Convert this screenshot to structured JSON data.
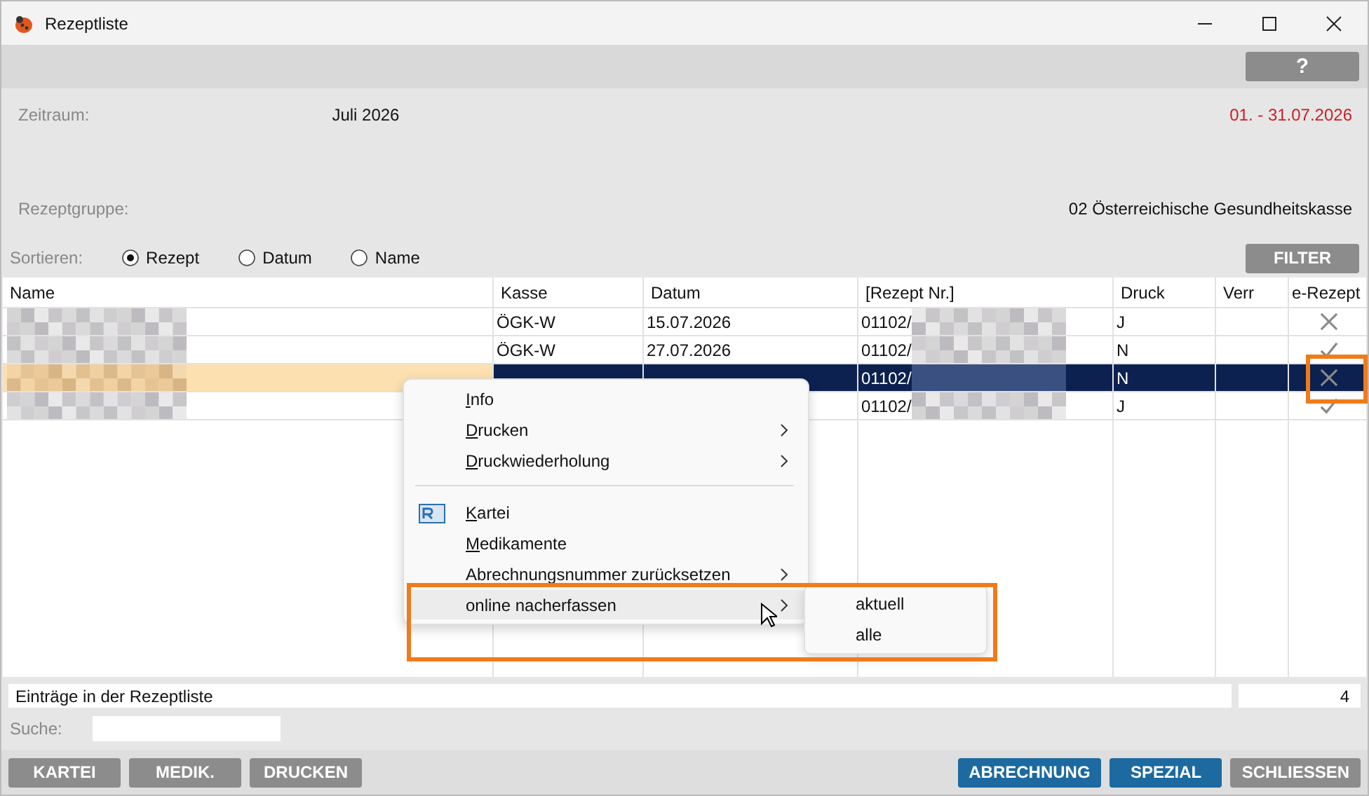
{
  "window": {
    "title": "Rezeptliste"
  },
  "help_button": "?",
  "period": {
    "label": "Zeitraum:",
    "value": "Juli 2026",
    "range": "01. - 31.07.2026"
  },
  "group": {
    "label": "Rezeptgruppe:",
    "value": "02 Österreichische Gesundheitskasse"
  },
  "sort": {
    "label": "Sortieren:",
    "options": [
      {
        "label": "Rezept",
        "selected": true
      },
      {
        "label": "Datum",
        "selected": false
      },
      {
        "label": "Name",
        "selected": false
      }
    ]
  },
  "filter_button": "FILTER",
  "table": {
    "columns": [
      "Name",
      "Kasse",
      "Datum",
      "[Rezept Nr.]",
      "Druck",
      "Verr",
      "e-Rezept"
    ],
    "rows": [
      {
        "kasse": "ÖGK-W",
        "datum": "15.07.2026",
        "rezept_nr": "01102/",
        "druck": "J",
        "kind": "cross",
        "selected": false
      },
      {
        "kasse": "ÖGK-W",
        "datum": "27.07.2026",
        "rezept_nr": "01102/",
        "druck": "N",
        "kind": "check",
        "selected": false
      },
      {
        "rezept_nr": "01102/",
        "druck": "N",
        "kind": "cross",
        "selected": true
      },
      {
        "rezept_nr": "01102/",
        "druck": "J",
        "kind": "check",
        "selected": false
      }
    ]
  },
  "context_menu": {
    "items": [
      {
        "label": "Info",
        "kind": "item",
        "underline_first": true,
        "submenu": false,
        "selected": false
      },
      {
        "label": "Drucken",
        "kind": "item",
        "underline_first": true,
        "submenu": true,
        "selected": false
      },
      {
        "label": "Druckwiederholung",
        "kind": "item",
        "underline_first": true,
        "submenu": true,
        "selected": false
      },
      {
        "kind": "separator"
      },
      {
        "label": "Kartei",
        "kind": "card",
        "underline_first": true,
        "submenu": false,
        "selected": false
      },
      {
        "label": "Medikamente",
        "kind": "item",
        "underline_first": true,
        "submenu": false,
        "selected": false
      },
      {
        "label": "Abrechnungsnummer zurücksetzen",
        "kind": "item",
        "underline_first": false,
        "submenu": true,
        "selected": false
      },
      {
        "label": "online nacherfassen",
        "kind": "item",
        "underline_first": false,
        "submenu": true,
        "selected": true
      }
    ],
    "submenu": [
      "aktuell",
      "alle"
    ]
  },
  "summary": {
    "label": "Einträge in der Rezeptliste",
    "count": "4"
  },
  "search": {
    "label": "Suche:"
  },
  "buttons": [
    {
      "label": "KARTEI",
      "kind": "grey"
    },
    {
      "label": "MEDIK.",
      "kind": "grey"
    },
    {
      "label": "DRUCKEN",
      "kind": "grey"
    },
    {
      "label": "ABRECHNUNG",
      "kind": "blue"
    },
    {
      "label": "SPEZIAL",
      "kind": "blue"
    },
    {
      "label": "SCHLIESSEN",
      "kind": "grey"
    }
  ]
}
